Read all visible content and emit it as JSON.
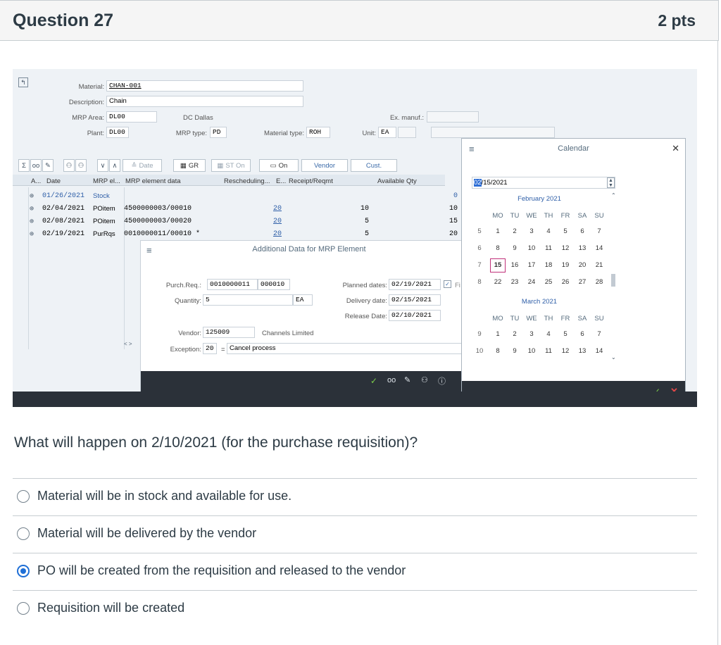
{
  "question": {
    "title": "Question 27",
    "points": "2 pts",
    "text": "What will happen on 2/10/2021 (for the purchase requisition)?",
    "options": [
      {
        "label": "Material will be in stock and available for use.",
        "selected": false
      },
      {
        "label": "Material will be delivered by the vendor",
        "selected": false
      },
      {
        "label": "PO will be created from the requisition and released to the vendor",
        "selected": true
      },
      {
        "label": "Requisition will be created",
        "selected": false
      }
    ]
  },
  "sap": {
    "header": {
      "material_label": "Material:",
      "material": "CHAN-001",
      "description_label": "Description:",
      "description": "Chain",
      "mrp_area_label": "MRP Area:",
      "mrp_area": "DL00",
      "mrp_area_text": "DC Dallas",
      "ex_manuf_label": "Ex. manuf.:",
      "plant_label": "Plant:",
      "plant": "DL00",
      "mrp_type_label": "MRP type:",
      "mrp_type": "PD",
      "material_type_label": "Material type:",
      "material_type": "ROH",
      "unit_label": "Unit:",
      "unit": "EA"
    },
    "toolbar": {
      "date": "Date",
      "gr": "GR",
      "st_on": "ST On",
      "on": "On",
      "vendor": "Vendor",
      "cust": "Cust."
    },
    "grid": {
      "columns": [
        "A...",
        "Date",
        "MRP el...",
        "MRP element data",
        "Rescheduling...",
        "E...",
        "Receipt/Reqmt",
        "Available Qty"
      ],
      "rows": [
        {
          "date": "01/26/2021",
          "element": "Stock",
          "data": "",
          "resched": "",
          "receipt": "",
          "available": "0"
        },
        {
          "date": "02/04/2021",
          "element": "POitem",
          "data": "4500000003/00010",
          "resched": "20",
          "receipt": "10",
          "available": "10"
        },
        {
          "date": "02/08/2021",
          "element": "POitem",
          "data": "4500000003/00020",
          "resched": "20",
          "receipt": "5",
          "available": "15"
        },
        {
          "date": "02/19/2021",
          "element": "PurRqs",
          "data": "0010000011/00010 *",
          "resched": "20",
          "receipt": "5",
          "available": "20"
        }
      ]
    },
    "dialog": {
      "title": "Additional Data for MRP Element",
      "purch_req_label": "Purch.Req.:",
      "purch_req": "0010000011",
      "purch_req_item": "000010",
      "quantity_label": "Quantity:",
      "quantity": "5",
      "quantity_unit": "EA",
      "vendor_label": "Vendor:",
      "vendor": "125009",
      "vendor_name": "Channels Limited",
      "exception_label": "Exception:",
      "exception": "20",
      "exception_eq": "=",
      "exception_text": "Cancel process",
      "planned_label": "Planned dates:",
      "planned": "02/19/2021",
      "firm_label": "Fi",
      "delivery_label": "Delivery date:",
      "delivery": "02/15/2021",
      "release_label": "Release Date:",
      "release": "02/10/2021"
    },
    "calendar": {
      "title": "Calendar",
      "input_sel": "02",
      "input_rest": "/15/2021",
      "feb_label": "February 2021",
      "mar_label": "March 2021",
      "weekdays": [
        "MO",
        "TU",
        "WE",
        "TH",
        "FR",
        "SA",
        "SU"
      ],
      "feb_weeks": [
        {
          "wk": "5",
          "days": [
            "1",
            "2",
            "3",
            "4",
            "5",
            "6",
            "7"
          ]
        },
        {
          "wk": "6",
          "days": [
            "8",
            "9",
            "10",
            "11",
            "12",
            "13",
            "14"
          ]
        },
        {
          "wk": "7",
          "days": [
            "15",
            "16",
            "17",
            "18",
            "19",
            "20",
            "21"
          ]
        },
        {
          "wk": "8",
          "days": [
            "22",
            "23",
            "24",
            "25",
            "26",
            "27",
            "28"
          ]
        }
      ],
      "mar_weeks": [
        {
          "wk": "9",
          "days": [
            "1",
            "2",
            "3",
            "4",
            "5",
            "6",
            "7"
          ]
        },
        {
          "wk": "10",
          "days": [
            "8",
            "9",
            "10",
            "11",
            "12",
            "13",
            "14"
          ]
        }
      ],
      "selected_day": "15"
    },
    "colors": {
      "accent": "#1f6fd6",
      "link": "#2f5fa8",
      "dark_bar": "#2b3139"
    }
  }
}
